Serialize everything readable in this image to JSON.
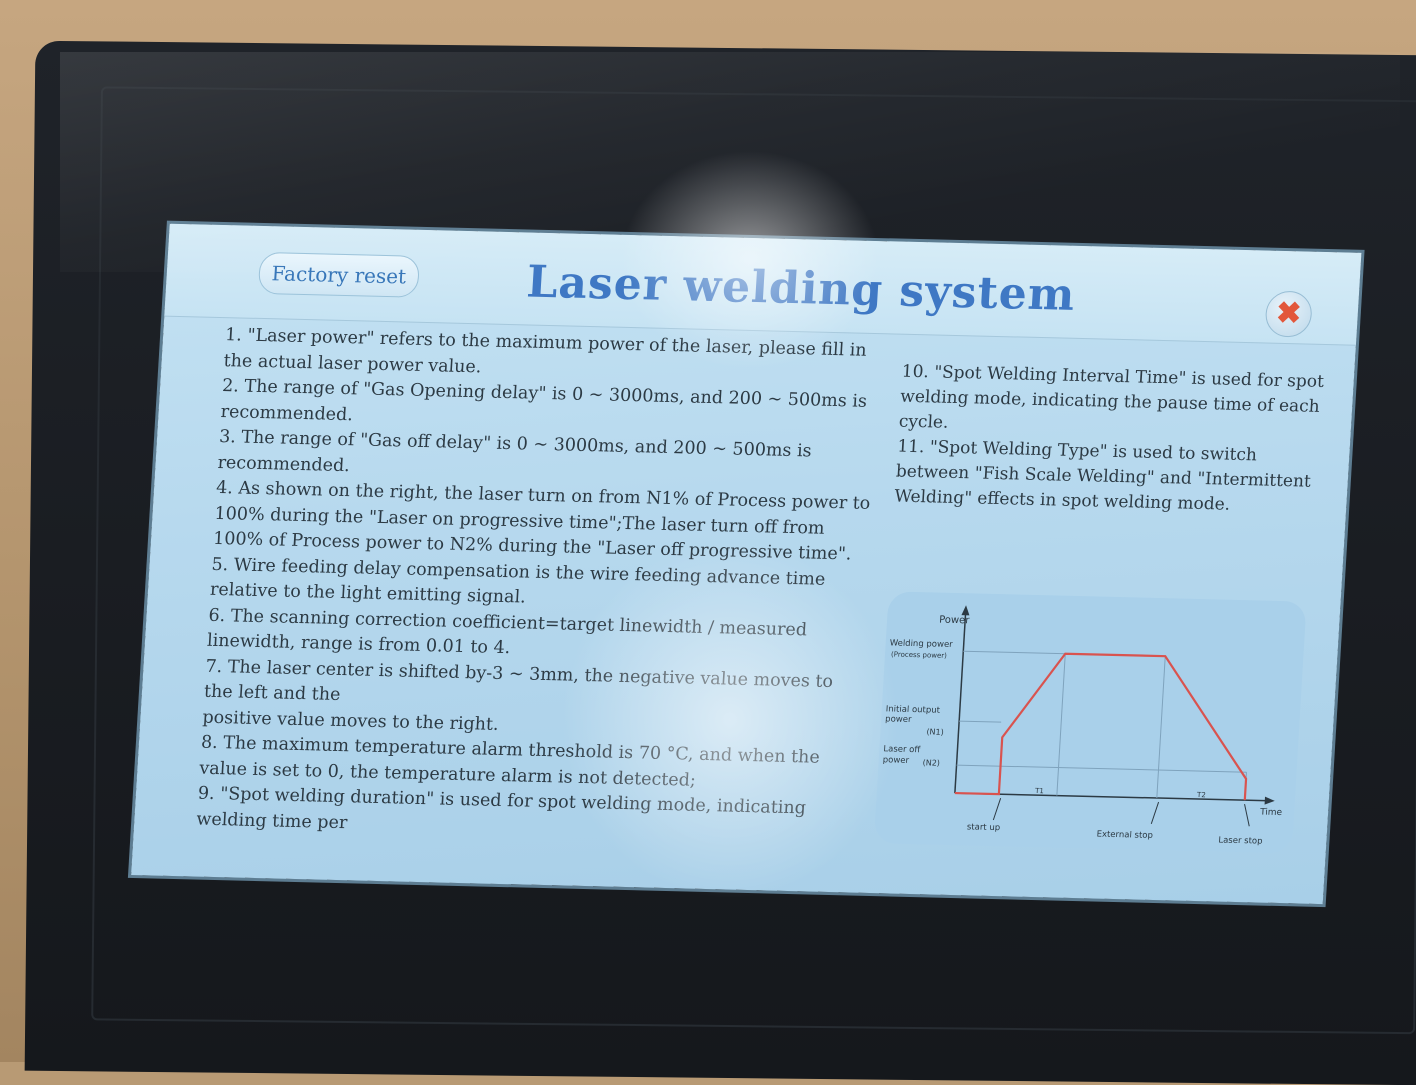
{
  "header": {
    "reset_button": "Factory reset",
    "title": "Laser welding system",
    "close_symbol": "✖"
  },
  "instructions_left": [
    "1. \"Laser power\" refers to the maximum power of the laser, please fill in the actual laser power value.",
    "2. The range of \"Gas Opening delay\" is 0 ~ 3000ms, and 200 ~ 500ms is recommended.",
    "3. The range of \"Gas off delay\" is 0 ~ 3000ms, and 200 ~ 500ms is recommended.",
    "4. As shown on the right, the laser turn on from N1% of Process power to 100% during the \"Laser on progressive time\";The laser turn off from 100% of Process power to N2% during the \"Laser off progressive time\".",
    "5. Wire feeding delay compensation is the wire feeding advance time relative to the light emitting signal.",
    "6. The scanning correction coefficient=target linewidth / measured linewidth, range is from 0.01 to 4.",
    "7. The laser center is shifted by-3 ~ 3mm, the negative value moves to the left and the",
    "positive value moves to the right.",
    "8. The maximum temperature alarm threshold is 70 °C, and when the value is set to 0, the temperature alarm is not detected;",
    "9. \"Spot welding duration\" is used for spot welding mode, indicating welding time per"
  ],
  "instructions_right": [
    "10. \"Spot Welding Interval Time\" is used for spot welding mode, indicating the pause time of each cycle.",
    "11. \"Spot Welding Type\" is used to switch between \"Fish Scale Welding\" and \"Intermittent Welding\" effects in spot welding mode."
  ],
  "chart_data": {
    "type": "line",
    "title": "",
    "xlabel": "Time",
    "ylabel": "Power",
    "y_labels": {
      "welding_power": "Welding power",
      "welding_power_sub": "(Process power)",
      "initial_output": "Initial output",
      "initial_output_2": "power",
      "n1": "(N1)",
      "laser_off": "Laser off",
      "laser_off_2": "power",
      "n2": "(N2)"
    },
    "x_labels": {
      "t1": "T1",
      "t2": "T2",
      "start_up": "start up",
      "external_stop": "External stop",
      "laser_stop": "Laser stop"
    },
    "series": [
      {
        "values": [
          0,
          0.4,
          1.0,
          1.0,
          0.15
        ]
      }
    ],
    "x": [
      0,
      0,
      1,
      2,
      3
    ],
    "colors": {
      "line": "#d9534f",
      "axis": "#2c3a44",
      "grid": "#7fa3bd"
    }
  }
}
